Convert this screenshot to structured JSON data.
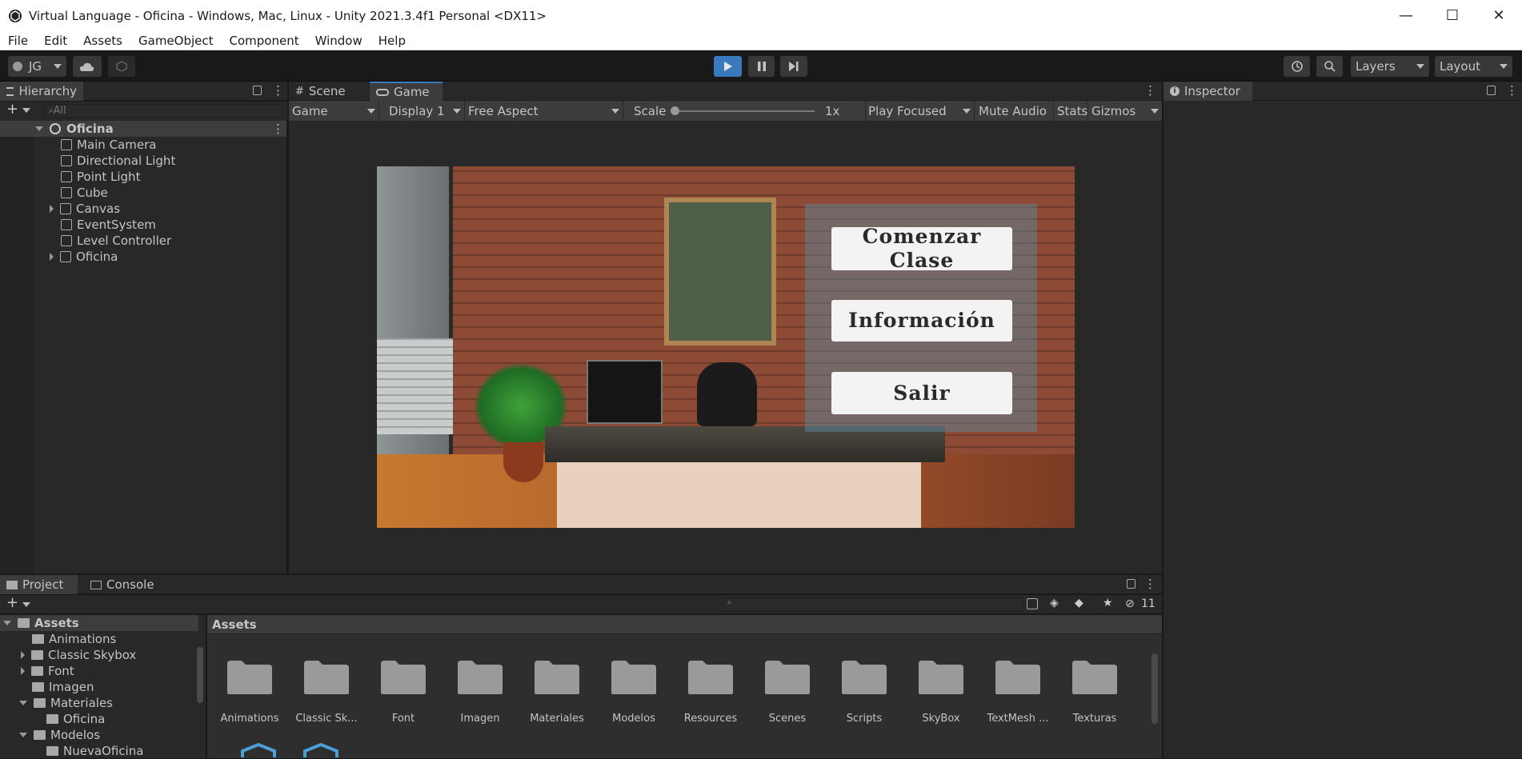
{
  "window": {
    "title": "Virtual Language - Oficina - Windows, Mac, Linux - Unity 2021.3.4f1 Personal <DX11>",
    "minimize": "—",
    "maximize": "☐",
    "close": "✕"
  },
  "menu": [
    "File",
    "Edit",
    "Assets",
    "GameObject",
    "Component",
    "Window",
    "Help"
  ],
  "toolbar": {
    "account": "JG",
    "layers": "Layers",
    "layout": "Layout"
  },
  "hierarchy": {
    "tab": "Hierarchy",
    "search_placeholder": "All",
    "scene": "Oficina",
    "items": [
      {
        "label": "Main Camera",
        "expandable": false
      },
      {
        "label": "Directional Light",
        "expandable": false
      },
      {
        "label": "Point Light",
        "expandable": false
      },
      {
        "label": "Cube",
        "expandable": false
      },
      {
        "label": "Canvas",
        "expandable": true
      },
      {
        "label": "EventSystem",
        "expandable": false
      },
      {
        "label": "Level Controller",
        "expandable": false
      },
      {
        "label": "Oficina",
        "expandable": true
      }
    ]
  },
  "view_tabs": {
    "scene": "Scene",
    "game": "Game"
  },
  "game_bar": {
    "mode": "Game",
    "display": "Display 1",
    "aspect": "Free Aspect",
    "scale_label": "Scale",
    "scale_value": "1x",
    "play_mode": "Play Focused",
    "mute": "Mute Audio",
    "stats": "Stats",
    "gizmos": "Gizmos"
  },
  "game_view": {
    "buttons": [
      "Comenzar Clase",
      "Información",
      "Salir"
    ]
  },
  "inspector": {
    "tab": "Inspector"
  },
  "project": {
    "tabs": {
      "project": "Project",
      "console": "Console"
    },
    "hidden_count": "11",
    "breadcrumb": "Assets",
    "tree": [
      {
        "label": "Assets",
        "depth": 0,
        "expanded": true,
        "bold": true
      },
      {
        "label": "Animations",
        "depth": 1,
        "expandable": false
      },
      {
        "label": "Classic Skybox",
        "depth": 1,
        "expandable": true
      },
      {
        "label": "Font",
        "depth": 1,
        "expandable": true
      },
      {
        "label": "Imagen",
        "depth": 1,
        "expandable": false
      },
      {
        "label": "Materiales",
        "depth": 1,
        "expanded": true
      },
      {
        "label": "Oficina",
        "depth": 2,
        "expandable": false
      },
      {
        "label": "Modelos",
        "depth": 1,
        "expanded": true
      },
      {
        "label": "NuevaOficina",
        "depth": 2,
        "expandable": false
      }
    ],
    "folders": [
      "Animations",
      "Classic Sk...",
      "Font",
      "Imagen",
      "Materiales",
      "Modelos",
      "Resources",
      "Scenes",
      "Scripts",
      "SkyBox",
      "TextMesh ...",
      "Texturas"
    ]
  },
  "colors": {
    "accent": "#3a79bb",
    "panel": "#282828",
    "header": "#3c3c3c",
    "brick": "#8a4a35"
  }
}
